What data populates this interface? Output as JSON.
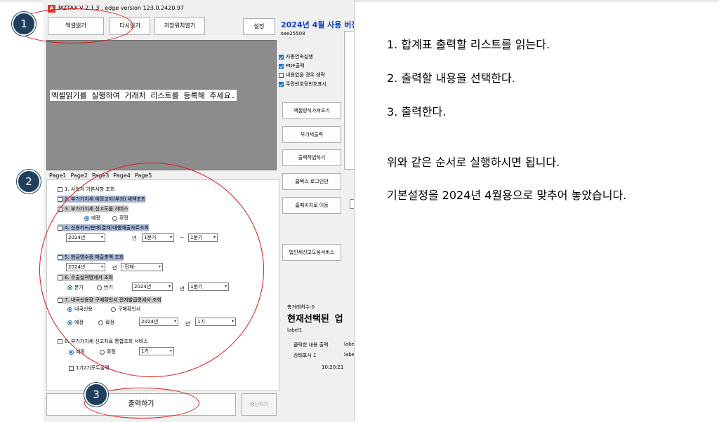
{
  "window": {
    "title": "MZTAX V 2.1.3 , edge version 123.0.2420.97",
    "app_icon": "A",
    "version_banner": "2024년 4월 사용 버전",
    "user_id": "see25508"
  },
  "toolbar": {
    "excel_read": "엑셀읽기",
    "reread": "다시읽기",
    "open_save_location": "저장위치열기",
    "settings": "설정"
  },
  "main_panel": {
    "message": "엑셀읽기를 실행하여 거래처 리스트를 등록해 주세요."
  },
  "options": [
    {
      "label": "자동연속실행",
      "checked": true
    },
    {
      "label": "PDF출력",
      "checked": true
    },
    {
      "label": "내용없을 경우 생략",
      "checked": false
    },
    {
      "label": "주민번호뒷번호표시",
      "checked": true
    }
  ],
  "side_buttons": {
    "excel_template": "엑셀양식가져오기",
    "vat_output": "부가세출력",
    "output_job": "출력작업하기",
    "hometax_login": "홈택스 로그인만",
    "go_homepage": "홈페이지로 이동",
    "corp_tax_service": "법인세신고도움서비스"
  },
  "tabs": [
    "Page1",
    "Page2",
    "Page3",
    "Page4",
    "Page5"
  ],
  "items": {
    "i1": "1. 사업자 기본사항 조회",
    "i2": "2. 부가가치세 예정고지(부과) 세액조회",
    "i3": "3. 부가가치세 신고도움 서비스",
    "i3_opt1": "예정",
    "i3_opt2": "확정",
    "i4": "4. 신용카드/판매(결제)대행매출자료조회",
    "i4_year": "2024년",
    "i4_year_unit": "년",
    "i4_q1": "1분기",
    "i4_tilde": "~",
    "i4_q2": "1분기",
    "i5": "5. 현금영수증 매출총액 조회",
    "i5_year": "2024년",
    "i5_year_unit": "년",
    "i5_all": "-전체-",
    "i6": "6. 수출실적명세서 조회",
    "i6_opt1": "분기",
    "i6_opt2": "반기",
    "i6_year": "2024년",
    "i6_year_unit": "년",
    "i6_q": "1분기",
    "i7": "7. 내국신용장 구매확인서 전자발급명세서 조회",
    "i7_opt1": "내국신용",
    "i7_opt2": "구매확인서",
    "i7_opt3": "예정",
    "i7_opt4": "확정",
    "i7_year": "2024년",
    "i7_year_unit": "년",
    "i7_period": "1기",
    "i8": "8. 부가가치세 신고자료 통합조회 서비스",
    "i8_opt1": "예정",
    "i8_opt2": "확정",
    "i8_period": "1기",
    "i8_sub": "1기2기모두출력"
  },
  "bottom": {
    "print": "출력하기",
    "stop": "중단하기"
  },
  "status": {
    "client_count": "총거래처수:0",
    "current_title": "현재선택된 업",
    "label1": "label1",
    "click_output": "클릭한 내용 출력",
    "status_display": "상태표시 1",
    "label_a": "labe",
    "label_b": "labe",
    "time": "10:20:21",
    "right_b": "1"
  },
  "annotations": {
    "step1": "1",
    "step2": "2",
    "step3": "3"
  },
  "instructions": {
    "s1": "1.  합계표 출력할 리스트를 읽는다.",
    "s2": "2.  출력할 내용을 선택한다.",
    "s3": "3.  출력한다.",
    "p1": "위와 같은 순서로 실행하시면 됩니다.",
    "p2": "기본설정을 2024년 4월용으로 맞추어 놓았습니다."
  },
  "colors": {
    "annotation_red": "#e01818",
    "badge": "#1f3f5c",
    "accent_blue": "#1040c8",
    "highlight": "#a9b8d6"
  }
}
